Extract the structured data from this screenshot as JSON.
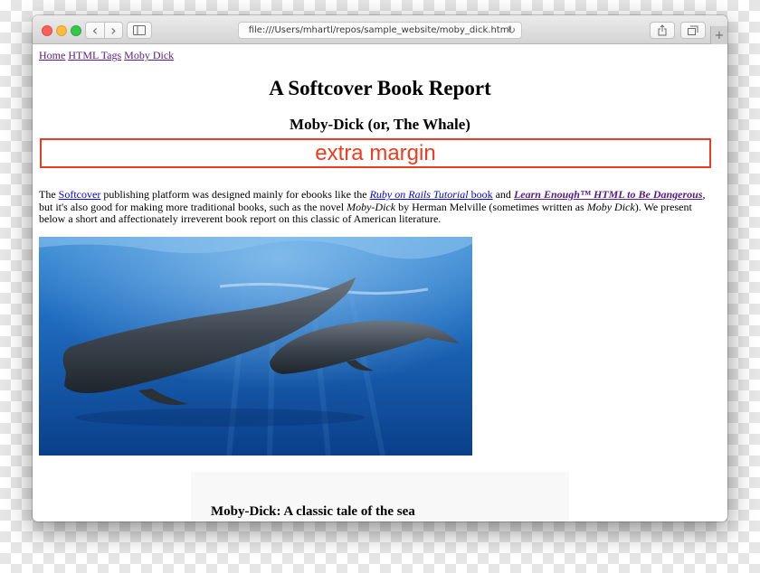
{
  "browser": {
    "url": "file:///Users/mhartl/repos/sample_website/moby_dick.html",
    "icons": {
      "back": "chevron-left-icon",
      "forward": "chevron-right-icon",
      "sidebar": "sidebar-icon",
      "reload": "reload-icon",
      "share": "share-icon",
      "tabs": "tabs-icon",
      "new_tab": "plus-icon"
    },
    "glyphs": {
      "back": "‹",
      "forward": "›",
      "reload": "↻",
      "share": "⇪",
      "new_tab": "+"
    }
  },
  "page": {
    "nav_links": [
      "Home",
      "HTML Tags",
      "Moby Dick"
    ],
    "title": "A Softcover Book Report",
    "subtitle": "Moby-Dick (or, The Whale)",
    "margin_label": "extra margin",
    "intro": {
      "t1": "The ",
      "link_softcover": "Softcover",
      "t2": " publishing platform was designed mainly for ebooks like the ",
      "link_rails": "Ruby on Rails Tutorial",
      "link_book": " book",
      "t3": " and ",
      "link_learn": "Learn Enough™ HTML to Be Dangerous",
      "t4": ", but it's also good for making more traditional books, such as the novel ",
      "em_moby1": "Moby-Dick",
      "t5": " by Herman Melville (sometimes written as ",
      "em_moby2": "Moby Dick",
      "t6": "). We present below a short and affectionately irreverent book report on this classic of American literature."
    },
    "image_subject": "sperm whales underwater",
    "sidebar_title": "Moby-Dick: A classic tale of the sea"
  },
  "colors": {
    "link": "#0000ee",
    "visited": "#551a8b",
    "margin_box": "#ef3b1f",
    "water_deep": "#0a3f8a",
    "water_light": "#3f8fd6"
  }
}
